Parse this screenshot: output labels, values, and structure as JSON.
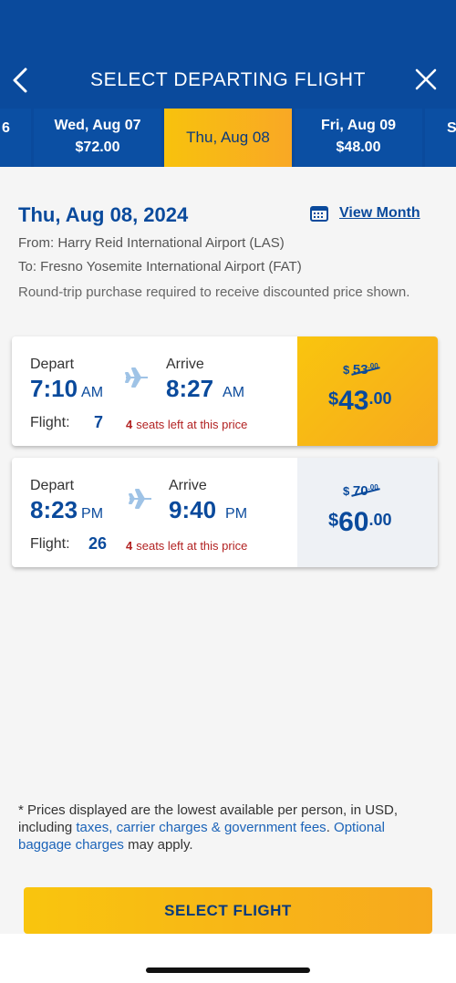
{
  "header": {
    "title": "SELECT DEPARTING FLIGHT",
    "back_icon": "chevron-left-icon",
    "close_icon": "close-icon"
  },
  "date_strip": {
    "left_partial": "6",
    "right_partial": "S",
    "days": [
      {
        "date": "Wed, Aug 07",
        "price": "$72.00",
        "selected": false
      },
      {
        "date": "Thu, Aug 08",
        "price": "",
        "selected": true
      },
      {
        "date": "Fri, Aug 09",
        "price": "$48.00",
        "selected": false
      }
    ]
  },
  "summary": {
    "date": "Thu, Aug 08, 2024",
    "view_month": "View Month",
    "from": "From: Harry Reid International Airport (LAS)",
    "to": "To: Fresno Yosemite International Airport (FAT)",
    "note": "Round-trip purchase required to receive discounted price shown."
  },
  "labels": {
    "depart": "Depart",
    "arrive": "Arrive",
    "flight": "Flight:",
    "seats_suffix": "seats left at this price"
  },
  "flights": [
    {
      "depart_time": "7:10",
      "depart_ampm": "AM",
      "arrive_time": "8:27",
      "arrive_ampm": "AM",
      "flight_number": "7",
      "seats_left": "4",
      "old_price_symbol": "$",
      "old_price": "53",
      "old_price_cents": ".00",
      "new_price_symbol": "$",
      "new_price": "43",
      "new_price_cents": ".00",
      "selected": true
    },
    {
      "depart_time": "8:23",
      "depart_ampm": "PM",
      "arrive_time": "9:40",
      "arrive_ampm": "PM",
      "flight_number": "26",
      "seats_left": "4",
      "old_price_symbol": "$",
      "old_price": "70",
      "old_price_cents": ".00",
      "new_price_symbol": "$",
      "new_price": "60",
      "new_price_cents": ".00",
      "selected": false
    }
  ],
  "footnote": {
    "part1": "* Prices displayed are the lowest available per person, in USD, including ",
    "link1": "taxes, carrier charges & government fees",
    "part2": ". ",
    "link2": "Optional baggage charges",
    "part3": " may apply."
  },
  "cta": {
    "label": "SELECT FLIGHT"
  },
  "colors": {
    "primary": "#0a4a9c",
    "accent": "#f9c50e",
    "warning": "#b22222"
  }
}
